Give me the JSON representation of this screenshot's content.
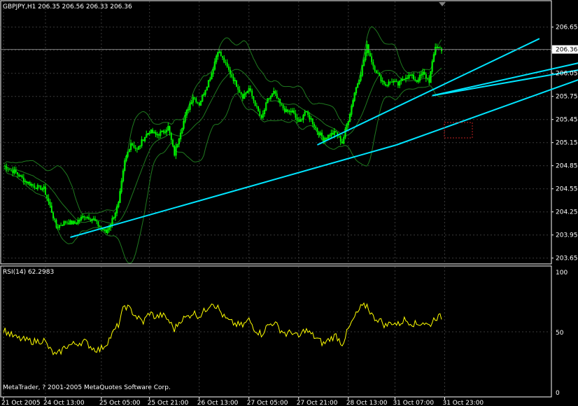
{
  "chart_data": [
    {
      "type": "line",
      "style": "candlestick",
      "title": "GBPJPY,H1  206.35 206.56 206.33 206.36",
      "current_price": "206.36",
      "y_ticks": [
        "206.65",
        "206.35",
        "206.05",
        "205.75",
        "205.45",
        "205.15",
        "204.85",
        "204.55",
        "204.25",
        "203.95",
        "203.65"
      ],
      "ylim": [
        203.62,
        206.82
      ],
      "x_ticks": [
        "21 Oct 2005",
        "24 Oct 13:00",
        "25 Oct 05:00",
        "25 Oct 21:00",
        "26 Oct 13:00",
        "27 Oct 05:00",
        "27 Oct 21:00",
        "28 Oct 13:00",
        "31 Oct 07:00",
        "31 Oct 23:00"
      ],
      "grid": true,
      "colors": {
        "bull": "#00ff00",
        "bear": "#00ff00",
        "bands": "#1f7a1f",
        "trendline": "#00e5ff",
        "rsi": "#ffff00",
        "grid": "#3a3a3a",
        "current_line": "#808080",
        "box": "#c02020"
      },
      "price_path": [
        [
          0,
          204.85
        ],
        [
          4,
          204.8
        ],
        [
          8,
          204.76
        ],
        [
          14,
          204.65
        ],
        [
          20,
          204.58
        ],
        [
          26,
          204.55
        ],
        [
          30,
          204.32
        ],
        [
          34,
          204.05
        ],
        [
          40,
          204.12
        ],
        [
          46,
          204.1
        ],
        [
          52,
          204.2
        ],
        [
          58,
          204.15
        ],
        [
          62,
          204.05
        ],
        [
          66,
          203.98
        ],
        [
          70,
          204.15
        ],
        [
          74,
          204.35
        ],
        [
          78,
          204.9
        ],
        [
          82,
          205.15
        ],
        [
          86,
          205.05
        ],
        [
          90,
          205.2
        ],
        [
          94,
          205.3
        ],
        [
          98,
          205.25
        ],
        [
          102,
          205.28
        ],
        [
          106,
          205.35
        ],
        [
          110,
          205.0
        ],
        [
          114,
          205.3
        ],
        [
          118,
          205.55
        ],
        [
          122,
          205.75
        ],
        [
          126,
          205.65
        ],
        [
          130,
          205.85
        ],
        [
          134,
          206.05
        ],
        [
          138,
          206.35
        ],
        [
          142,
          206.2
        ],
        [
          146,
          206.05
        ],
        [
          150,
          205.9
        ],
        [
          154,
          205.75
        ],
        [
          158,
          205.85
        ],
        [
          162,
          205.65
        ],
        [
          166,
          205.45
        ],
        [
          170,
          205.7
        ],
        [
          174,
          205.8
        ],
        [
          178,
          205.65
        ],
        [
          182,
          205.55
        ],
        [
          186,
          205.55
        ],
        [
          190,
          205.4
        ],
        [
          194,
          205.55
        ],
        [
          198,
          205.45
        ],
        [
          202,
          205.3
        ],
        [
          206,
          205.2
        ],
        [
          210,
          205.25
        ],
        [
          214,
          205.28
        ],
        [
          218,
          205.15
        ],
        [
          222,
          205.45
        ],
        [
          226,
          205.8
        ],
        [
          230,
          206.05
        ],
        [
          234,
          206.4
        ],
        [
          238,
          206.15
        ],
        [
          242,
          206.0
        ],
        [
          246,
          205.9
        ],
        [
          250,
          205.95
        ],
        [
          254,
          205.9
        ],
        [
          258,
          206.0
        ],
        [
          262,
          206.02
        ],
        [
          266,
          205.95
        ],
        [
          270,
          206.05
        ],
        [
          274,
          205.95
        ],
        [
          278,
          206.4
        ],
        [
          282,
          206.36
        ]
      ],
      "rsi": {
        "label": "RSI(14) 62.2983",
        "ticks": [
          "100",
          "50",
          "0"
        ],
        "ylim": [
          0,
          100
        ],
        "path": [
          [
            0,
            52
          ],
          [
            4,
            48
          ],
          [
            8,
            45
          ],
          [
            14,
            43
          ],
          [
            20,
            42
          ],
          [
            26,
            43
          ],
          [
            30,
            35
          ],
          [
            34,
            30
          ],
          [
            40,
            38
          ],
          [
            46,
            40
          ],
          [
            52,
            42
          ],
          [
            58,
            36
          ],
          [
            62,
            35
          ],
          [
            66,
            40
          ],
          [
            70,
            48
          ],
          [
            74,
            56
          ],
          [
            78,
            72
          ],
          [
            82,
            68
          ],
          [
            86,
            62
          ],
          [
            90,
            58
          ],
          [
            94,
            66
          ],
          [
            98,
            62
          ],
          [
            102,
            64
          ],
          [
            106,
            60
          ],
          [
            110,
            52
          ],
          [
            114,
            60
          ],
          [
            118,
            62
          ],
          [
            122,
            66
          ],
          [
            126,
            63
          ],
          [
            130,
            68
          ],
          [
            134,
            75
          ],
          [
            138,
            70
          ],
          [
            142,
            62
          ],
          [
            146,
            58
          ],
          [
            150,
            56
          ],
          [
            154,
            55
          ],
          [
            158,
            60
          ],
          [
            162,
            52
          ],
          [
            166,
            48
          ],
          [
            170,
            55
          ],
          [
            174,
            58
          ],
          [
            178,
            52
          ],
          [
            182,
            48
          ],
          [
            186,
            50
          ],
          [
            190,
            45
          ],
          [
            194,
            52
          ],
          [
            198,
            48
          ],
          [
            202,
            44
          ],
          [
            206,
            40
          ],
          [
            210,
            44
          ],
          [
            214,
            47
          ],
          [
            218,
            40
          ],
          [
            222,
            52
          ],
          [
            226,
            62
          ],
          [
            230,
            70
          ],
          [
            234,
            72
          ],
          [
            238,
            62
          ],
          [
            242,
            60
          ],
          [
            246,
            55
          ],
          [
            250,
            58
          ],
          [
            254,
            56
          ],
          [
            258,
            60
          ],
          [
            262,
            58
          ],
          [
            266,
            56
          ],
          [
            270,
            58
          ],
          [
            274,
            55
          ],
          [
            278,
            62
          ],
          [
            282,
            62.3
          ]
        ]
      },
      "trendlines": [
        {
          "from": [
            43,
            203.92
          ],
          "to": [
            253,
            205.12
          ]
        },
        {
          "from": [
            253,
            205.12
          ],
          "to": [
            372,
            205.98
          ]
        },
        {
          "from": [
            202,
            205.12
          ],
          "to": [
            345,
            206.5
          ]
        },
        {
          "from": [
            276,
            205.76
          ],
          "to": [
            385,
            206.25
          ]
        },
        {
          "from": [
            276,
            205.76
          ],
          "to": [
            378,
            206.12
          ]
        }
      ]
    }
  ],
  "footer": "MetaTrader, ? 2001-2005 MetaQuotes Software Corp."
}
